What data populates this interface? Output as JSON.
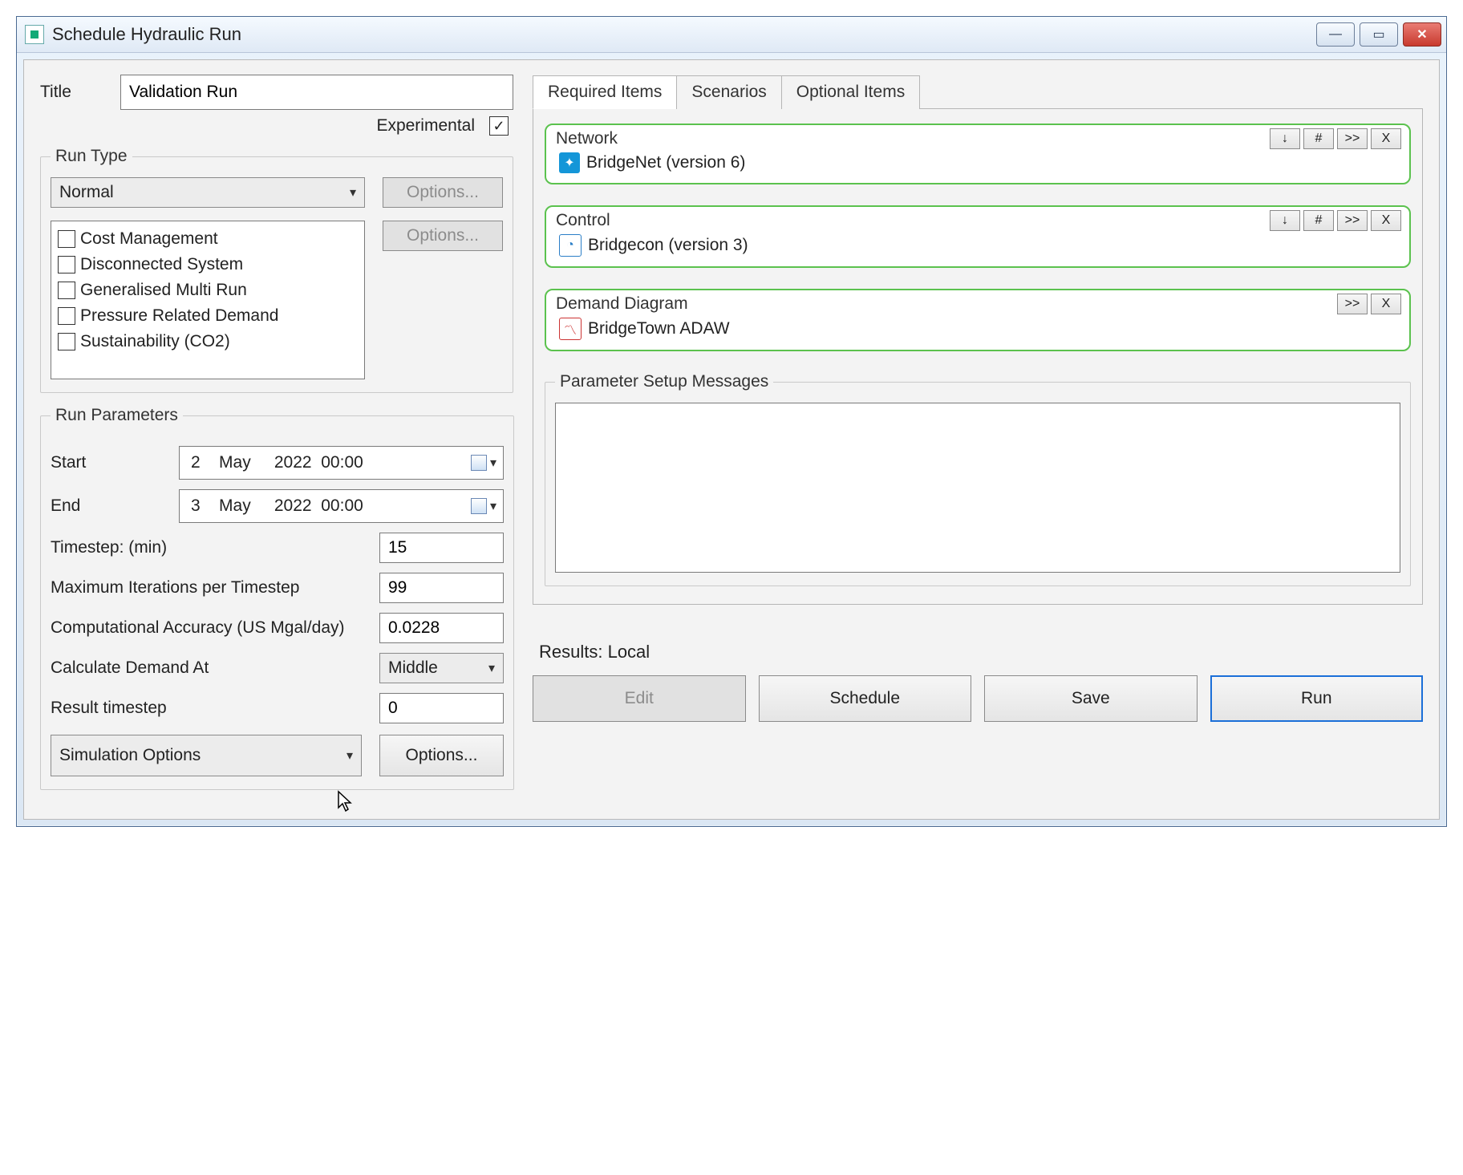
{
  "window": {
    "title": "Schedule Hydraulic Run"
  },
  "title_field": {
    "label": "Title",
    "value": "Validation Run"
  },
  "experimental": {
    "label": "Experimental",
    "checked": true
  },
  "run_type": {
    "legend": "Run Type",
    "selected": "Normal",
    "options_btn1": "Options...",
    "options_btn2": "Options...",
    "checks": [
      "Cost Management",
      "Disconnected System",
      "Generalised Multi Run",
      "Pressure Related Demand",
      "Sustainability (CO2)"
    ]
  },
  "run_params": {
    "legend": "Run Parameters",
    "start_label": "Start",
    "start_value": "2    May     2022  00:00",
    "end_label": "End",
    "end_value": "3    May     2022  00:00",
    "timestep_label": "Timestep: (min)",
    "timestep_value": "15",
    "maxiter_label": "Maximum Iterations per Timestep",
    "maxiter_value": "99",
    "accuracy_label": "Computational Accuracy (US Mgal/day)",
    "accuracy_value": "0.0228",
    "calc_label": "Calculate Demand At",
    "calc_value": "Middle",
    "result_ts_label": "Result timestep",
    "result_ts_value": "0",
    "sim_opts_label": "Simulation Options",
    "sim_opts_btn": "Options..."
  },
  "tabs": {
    "required": "Required Items",
    "scenarios": "Scenarios",
    "optional": "Optional Items"
  },
  "required_items": {
    "network": {
      "title": "Network",
      "value": "BridgeNet (version 6)"
    },
    "control": {
      "title": "Control",
      "value": "Bridgecon (version 3)"
    },
    "demand": {
      "title": "Demand Diagram",
      "value": "BridgeTown ADAW"
    }
  },
  "mini_btn": {
    "down": "↓",
    "hash": "#",
    "next": ">>",
    "close": "X"
  },
  "messages": {
    "legend": "Parameter Setup Messages"
  },
  "results": {
    "label": "Results: Local",
    "edit": "Edit",
    "schedule": "Schedule",
    "save": "Save",
    "run": "Run"
  }
}
